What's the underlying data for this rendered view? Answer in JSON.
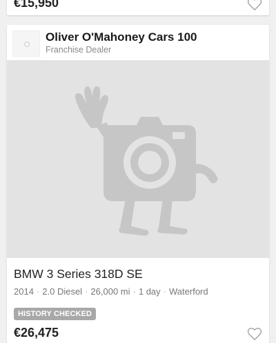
{
  "previous_listing": {
    "price": "€15,950"
  },
  "listing": {
    "dealer": {
      "name": "Oliver O'Mahoney Cars 100",
      "type": "Franchise Dealer"
    },
    "title": "BMW 3 Series 318D SE",
    "specs": {
      "year": "2014",
      "engine": "2.0 Diesel",
      "mileage": "26,000 mi",
      "age": "1 day",
      "location": "Waterford"
    },
    "badge": "HISTORY CHECKED",
    "price": "€26,475",
    "image": "placeholder-camera-icon"
  },
  "colors": {
    "placeholder_bg": "#e3e3e3",
    "placeholder_icon": "#c6c6c6",
    "badge_bg": "#a8a8a8"
  }
}
